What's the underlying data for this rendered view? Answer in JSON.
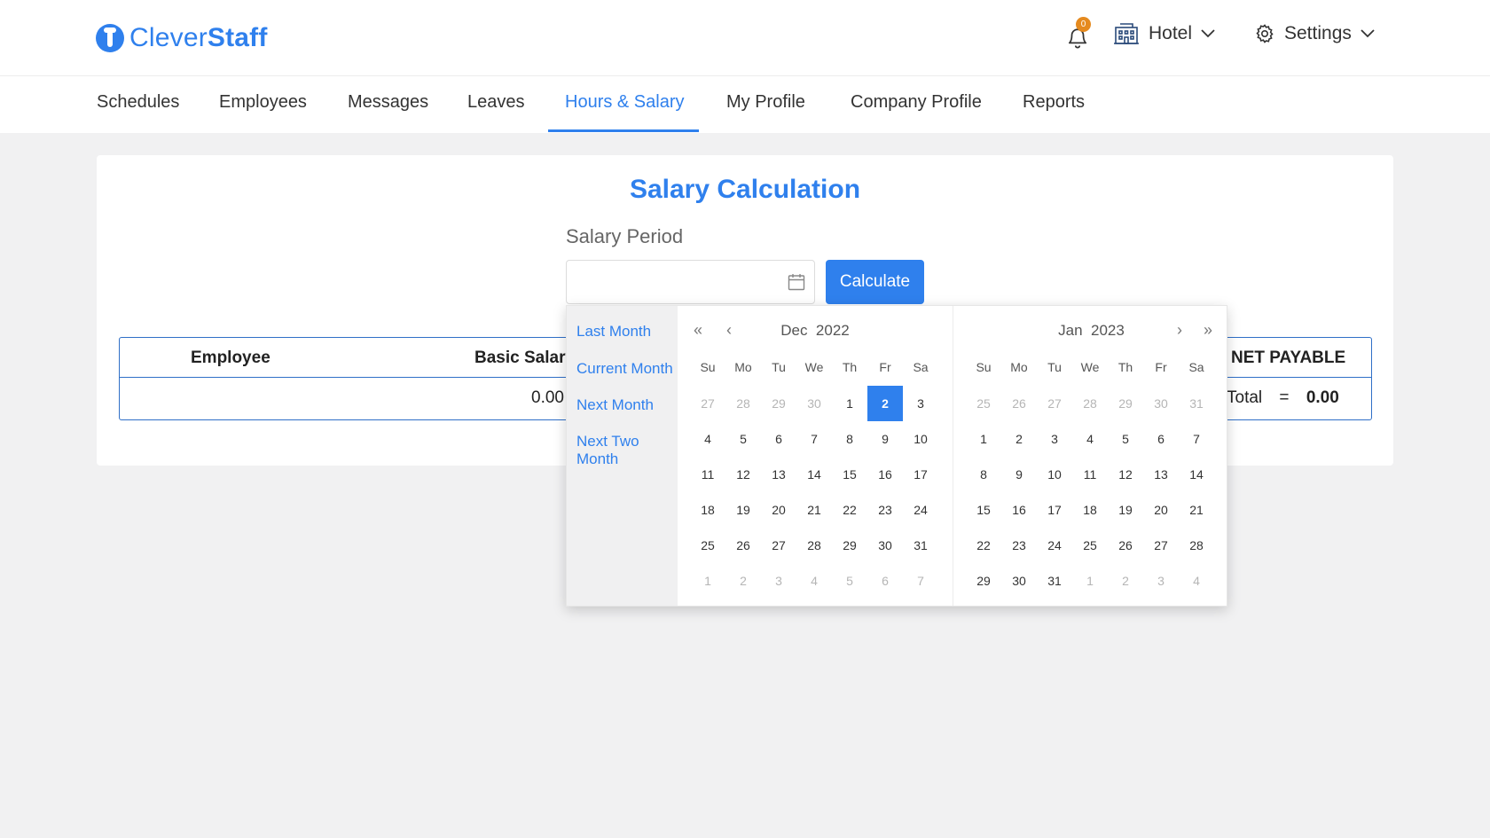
{
  "app": {
    "brand_light": "Clever",
    "brand_bold": "Staff",
    "notification_count": "0",
    "location": "Hotel",
    "settings_label": "Settings"
  },
  "nav": {
    "items": [
      "Schedules",
      "Employees",
      "Messages",
      "Leaves",
      "Hours & Salary",
      "My Profile",
      "Company Profile",
      "Reports"
    ],
    "active": "Hours & Salary"
  },
  "page": {
    "title": "Salary Calculation",
    "period_label": "Salary Period",
    "period_value": "",
    "calculate_label": "Calculate"
  },
  "table": {
    "headers": {
      "employee": "Employee",
      "basic_salary": "Basic Salary",
      "net_payable": "NET PAYABLE"
    },
    "basic_salary_value": "0.00",
    "total_label": "Total",
    "equals": "=",
    "total_value": "0.00"
  },
  "picker": {
    "ranges": [
      "Last Month",
      "Current Month",
      "Next Month",
      "Next Two Month"
    ],
    "nav_glyphs": {
      "prev_year": "«",
      "prev_month": "‹",
      "next_month": "›",
      "next_year": "»"
    },
    "weekdays": [
      "Su",
      "Mo",
      "Tu",
      "We",
      "Th",
      "Fr",
      "Sa"
    ],
    "left": {
      "month": "Dec",
      "year": "2022",
      "weeks": [
        [
          [
            "27",
            1
          ],
          [
            "28",
            1
          ],
          [
            "29",
            1
          ],
          [
            "30",
            1
          ],
          [
            "1",
            0
          ],
          [
            "2",
            2
          ],
          [
            "3",
            0
          ]
        ],
        [
          [
            "4",
            0
          ],
          [
            "5",
            0
          ],
          [
            "6",
            0
          ],
          [
            "7",
            0
          ],
          [
            "8",
            0
          ],
          [
            "9",
            0
          ],
          [
            "10",
            0
          ]
        ],
        [
          [
            "11",
            0
          ],
          [
            "12",
            0
          ],
          [
            "13",
            0
          ],
          [
            "14",
            0
          ],
          [
            "15",
            0
          ],
          [
            "16",
            0
          ],
          [
            "17",
            0
          ]
        ],
        [
          [
            "18",
            0
          ],
          [
            "19",
            0
          ],
          [
            "20",
            0
          ],
          [
            "21",
            0
          ],
          [
            "22",
            0
          ],
          [
            "23",
            0
          ],
          [
            "24",
            0
          ]
        ],
        [
          [
            "25",
            0
          ],
          [
            "26",
            0
          ],
          [
            "27",
            0
          ],
          [
            "28",
            0
          ],
          [
            "29",
            0
          ],
          [
            "30",
            0
          ],
          [
            "31",
            0
          ]
        ],
        [
          [
            "1",
            1
          ],
          [
            "2",
            1
          ],
          [
            "3",
            1
          ],
          [
            "4",
            1
          ],
          [
            "5",
            1
          ],
          [
            "6",
            1
          ],
          [
            "7",
            1
          ]
        ]
      ]
    },
    "right": {
      "month": "Jan",
      "year": "2023",
      "weeks": [
        [
          [
            "25",
            1
          ],
          [
            "26",
            1
          ],
          [
            "27",
            1
          ],
          [
            "28",
            1
          ],
          [
            "29",
            1
          ],
          [
            "30",
            1
          ],
          [
            "31",
            1
          ]
        ],
        [
          [
            "1",
            0
          ],
          [
            "2",
            0
          ],
          [
            "3",
            0
          ],
          [
            "4",
            0
          ],
          [
            "5",
            0
          ],
          [
            "6",
            0
          ],
          [
            "7",
            0
          ]
        ],
        [
          [
            "8",
            0
          ],
          [
            "9",
            0
          ],
          [
            "10",
            0
          ],
          [
            "11",
            0
          ],
          [
            "12",
            0
          ],
          [
            "13",
            0
          ],
          [
            "14",
            0
          ]
        ],
        [
          [
            "15",
            0
          ],
          [
            "16",
            0
          ],
          [
            "17",
            0
          ],
          [
            "18",
            0
          ],
          [
            "19",
            0
          ],
          [
            "20",
            0
          ],
          [
            "21",
            0
          ]
        ],
        [
          [
            "22",
            0
          ],
          [
            "23",
            0
          ],
          [
            "24",
            0
          ],
          [
            "25",
            0
          ],
          [
            "26",
            0
          ],
          [
            "27",
            0
          ],
          [
            "28",
            0
          ]
        ],
        [
          [
            "29",
            0
          ],
          [
            "30",
            0
          ],
          [
            "31",
            0
          ],
          [
            "1",
            1
          ],
          [
            "2",
            1
          ],
          [
            "3",
            1
          ],
          [
            "4",
            1
          ]
        ]
      ]
    }
  },
  "colors": {
    "accent": "#2f80ed",
    "badge": "#e58a1f",
    "page_bg": "#f1f1f2"
  }
}
